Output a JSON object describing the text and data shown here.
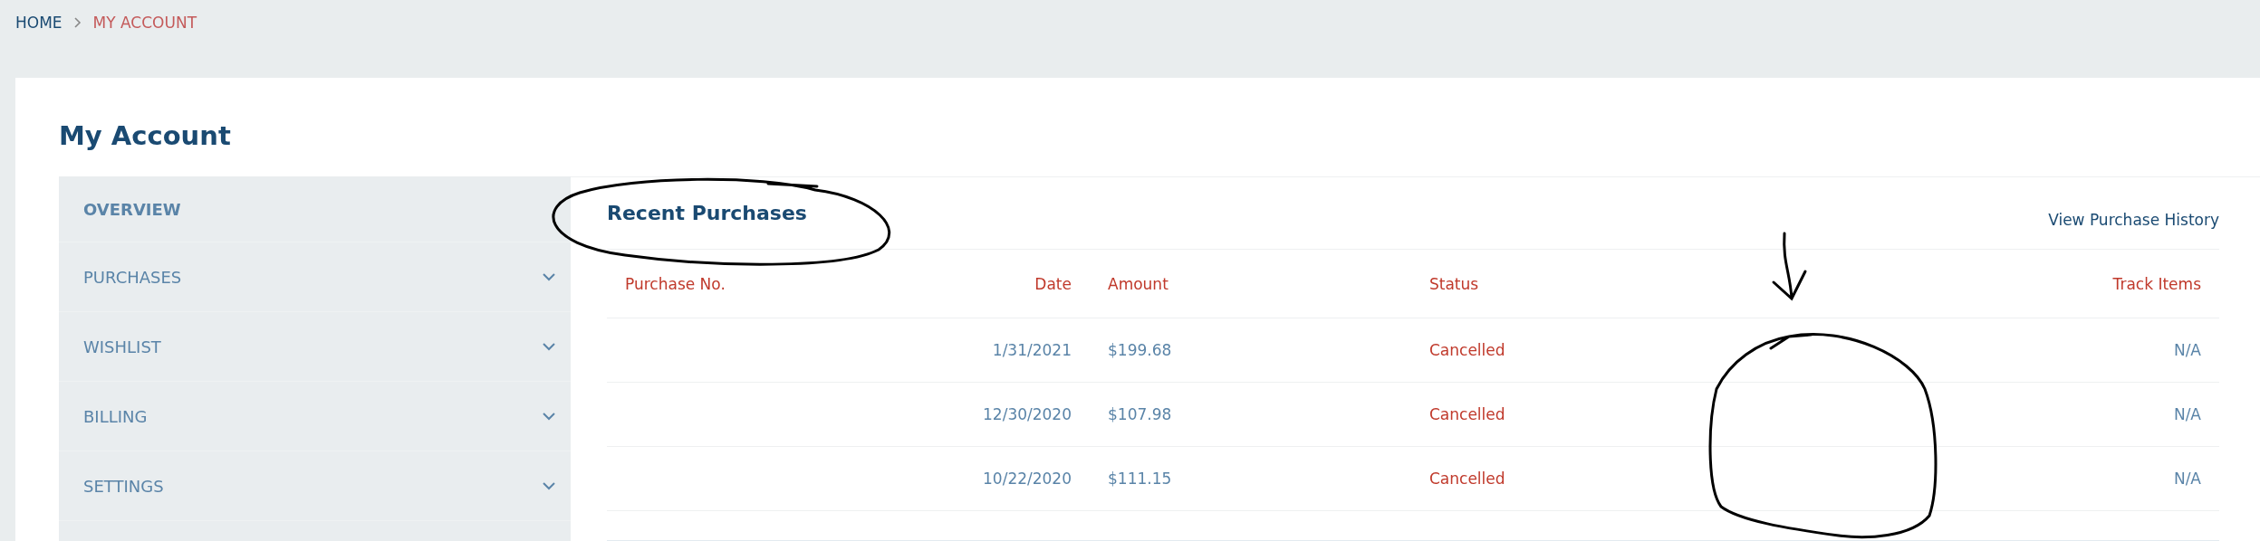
{
  "breadcrumb": [
    {
      "label": "HOME",
      "current": false
    },
    {
      "label": "MY ACCOUNT",
      "current": true
    }
  ],
  "page_title": "My Account",
  "sidebar": {
    "items": [
      {
        "label": "OVERVIEW",
        "selected": true,
        "expandable": false
      },
      {
        "label": "PURCHASES",
        "selected": false,
        "expandable": true
      },
      {
        "label": "WISHLIST",
        "selected": false,
        "expandable": true
      },
      {
        "label": "BILLING",
        "selected": false,
        "expandable": true
      },
      {
        "label": "SETTINGS",
        "selected": false,
        "expandable": true
      }
    ]
  },
  "recent_purchases": {
    "title": "Recent Purchases",
    "link": "View Purchase History",
    "columns": [
      "Purchase No.",
      "Date",
      "Amount",
      "Status",
      "Track Items"
    ],
    "rows": [
      {
        "date": "1/31/2021",
        "amount": "$199.68",
        "status": "Cancelled",
        "track_items": "N/A"
      },
      {
        "date": "12/30/2020",
        "amount": "$107.98",
        "status": "Cancelled",
        "track_items": "N/A"
      },
      {
        "date": "10/22/2020",
        "amount": "$111.15",
        "status": "Cancelled",
        "track_items": "N/A"
      }
    ]
  },
  "annotations": [
    {
      "kind": "ellipse"
    },
    {
      "kind": "arrow"
    },
    {
      "kind": "circle"
    }
  ]
}
